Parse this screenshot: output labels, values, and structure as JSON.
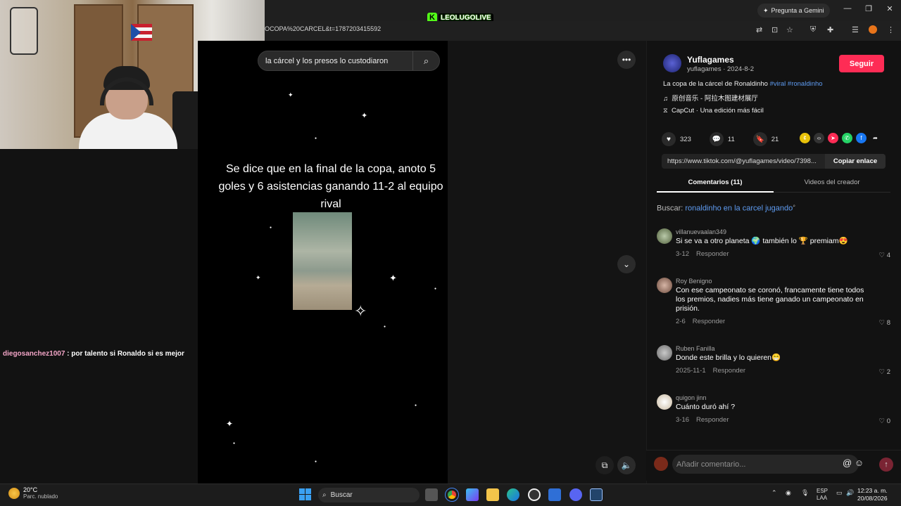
{
  "browser": {
    "url_fragment": "OCOPA%20CARCEL&t=1787203415592",
    "gemini_label": "Pregunta a Gemini",
    "kick_badge": "LEOLUGOLIVE"
  },
  "video": {
    "search_value": "la cárcel y los presos lo custodiaron",
    "caption": "Se dice que en la final de la copa, anoto 5 goles y 6 asistencias ganando 11-2 al equipo rival"
  },
  "stream_chat": {
    "user": "diegosanchez1007",
    "message": ": por talento si Ronaldo si es mejor"
  },
  "author": {
    "name": "Yuflagames",
    "meta": "yuflagames · 2024-8-2",
    "follow_label": "Seguir",
    "description": "La copa de la cárcel de Ronaldinho ",
    "tags": "#viral #ronaldinho",
    "music": "原创音乐 - 阿拉木图建材展厅",
    "capcut": "CapCut · Una edición más fácil"
  },
  "stats": {
    "likes": "323",
    "comments": "11",
    "saves": "21"
  },
  "link": {
    "url": "https://www.tiktok.com/@yuflagames/video/7398...",
    "copy_label": "Copiar enlace"
  },
  "tabs": {
    "comments": "Comentarios (11)",
    "creator_videos": "Videos del creador"
  },
  "search_suggestion": {
    "prefix": "Buscar: ",
    "query": "ronaldinho en la carcel jugando"
  },
  "comments": [
    {
      "user": "villanuevaalan349",
      "text": "Si se va a otro planeta 🌍 también lo 🏆 premiam😍",
      "date": "3-12",
      "reply": "Responder",
      "likes": "4"
    },
    {
      "user": "Roy Benigno",
      "text": "Con ese campeonato se coronó, francamente tiene todos los premios, nadies más tiene ganado un campeonato en prisión.",
      "date": "2-6",
      "reply": "Responder",
      "likes": "8"
    },
    {
      "user": "Ruben Fanilla",
      "text": "Donde este brilla y lo quieren😁",
      "date": "2025-11-1",
      "reply": "Responder",
      "likes": "2"
    },
    {
      "user": "quigon jinn",
      "text": "Cuánto duró ahí ?",
      "date": "3-16",
      "reply": "Responder",
      "likes": "0"
    }
  ],
  "comment_input": {
    "placeholder": "Añadir comentario..."
  },
  "taskbar": {
    "temp": "20°C",
    "weather": "Parc. nublado",
    "search": "Buscar",
    "lang1": "ESP",
    "lang2": "LAA",
    "time": "12:23 a. m.",
    "date": "20/08/2026"
  },
  "colors": {
    "accent": "#fe2c55",
    "link": "#5f9cf2",
    "kick": "#53fc18"
  }
}
